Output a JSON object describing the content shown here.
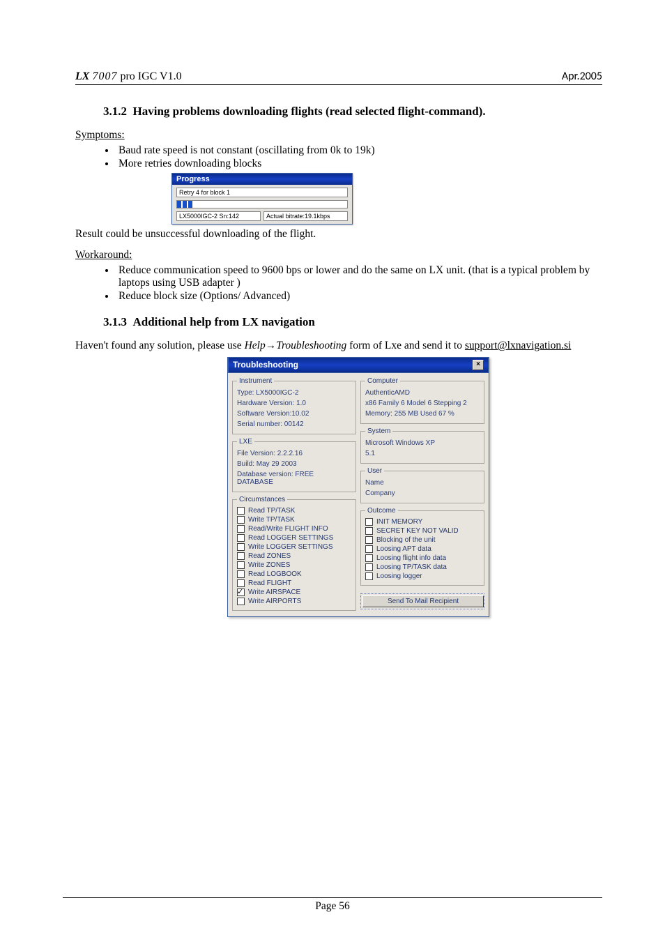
{
  "header": {
    "brand": "LX",
    "model": "7007",
    "suffix": " pro IGC  V1.0",
    "date": "Apr.2005"
  },
  "sections": {
    "s312": {
      "num": "3.1.2",
      "title": "Having problems downloading flights (read selected flight-command).",
      "symptoms_label": "Symptoms:",
      "symptoms": [
        "Baud rate speed is not constant (oscillating from 0k to 19k)",
        "More retries downloading blocks"
      ],
      "result_text": "Result could be unsuccessful downloading of the flight.",
      "workaround_label": "Workaround:",
      "workarounds": [
        "Reduce communication speed to 9600 bps or lower and do the same on LX unit. (that is a typical problem by laptops using USB adapter )",
        "Reduce block size (Options/ Advanced)"
      ]
    },
    "s313": {
      "num": "3.1.3",
      "title": "Additional help from LX navigation",
      "para_prefix": "Haven't found any solution, please use ",
      "help_text": "Help",
      "arrow": "→",
      "troubleshooting_text": "Troubleshooting",
      "para_mid": " form of Lxe and send it to ",
      "email": "support@lxnavigation.si"
    }
  },
  "progress": {
    "title": "Progress",
    "msg": "Retry 4 for block 1",
    "status_left": "LX5000IGC-2 Sn:142",
    "status_right": "Actual bitrate:19.1kbps"
  },
  "trouble": {
    "title": "Troubleshooting",
    "instrument": {
      "legend": "Instrument",
      "lines": [
        "Type: LX5000IGC-2",
        "Hardware Version: 1.0",
        "Software Version:10.02",
        "Serial number: 00142"
      ]
    },
    "lxe": {
      "legend": "LXE",
      "lines": [
        "File Version: 2.2.2.16",
        "Build: May 29 2003",
        "Database version: FREE DATABASE"
      ]
    },
    "circumstances": {
      "legend": "Circumstances",
      "items": [
        {
          "label": "Read TP/TASK",
          "checked": false
        },
        {
          "label": "Write TP/TASK",
          "checked": false
        },
        {
          "label": "Read/Write FLIGHT INFO",
          "checked": false
        },
        {
          "label": "Read LOGGER SETTINGS",
          "checked": false
        },
        {
          "label": "Write LOGGER SETTINGS",
          "checked": false
        },
        {
          "label": "Read ZONES",
          "checked": false
        },
        {
          "label": "Write ZONES",
          "checked": false
        },
        {
          "label": "Read LOGBOOK",
          "checked": false
        },
        {
          "label": "Read FLIGHT",
          "checked": false
        },
        {
          "label": "Write AIRSPACE",
          "checked": true
        },
        {
          "label": "Write AIRPORTS",
          "checked": false
        }
      ]
    },
    "computer": {
      "legend": "Computer",
      "lines": [
        "AuthenticAMD",
        "x86 Family 6 Model 6 Stepping 2",
        "Memory: 255 MB Used 67 %"
      ]
    },
    "system": {
      "legend": "System",
      "lines": [
        "Microsoft Windows XP",
        "5.1"
      ]
    },
    "user": {
      "legend": "User",
      "lines": [
        "Name",
        "Company"
      ]
    },
    "outcome": {
      "legend": "Outcome",
      "items": [
        {
          "label": "INIT MEMORY",
          "checked": false
        },
        {
          "label": "SECRET KEY NOT VALID",
          "checked": false
        },
        {
          "label": "Blocking of the unit",
          "checked": false
        },
        {
          "label": "Loosing APT data",
          "checked": false
        },
        {
          "label": "Loosing flight info data",
          "checked": false
        },
        {
          "label": "Loosing TP/TASK data",
          "checked": false
        },
        {
          "label": "Loosing logger",
          "checked": false
        }
      ]
    },
    "send_btn": "Send To Mail Recipient"
  },
  "footer": {
    "page": "Page 56"
  }
}
